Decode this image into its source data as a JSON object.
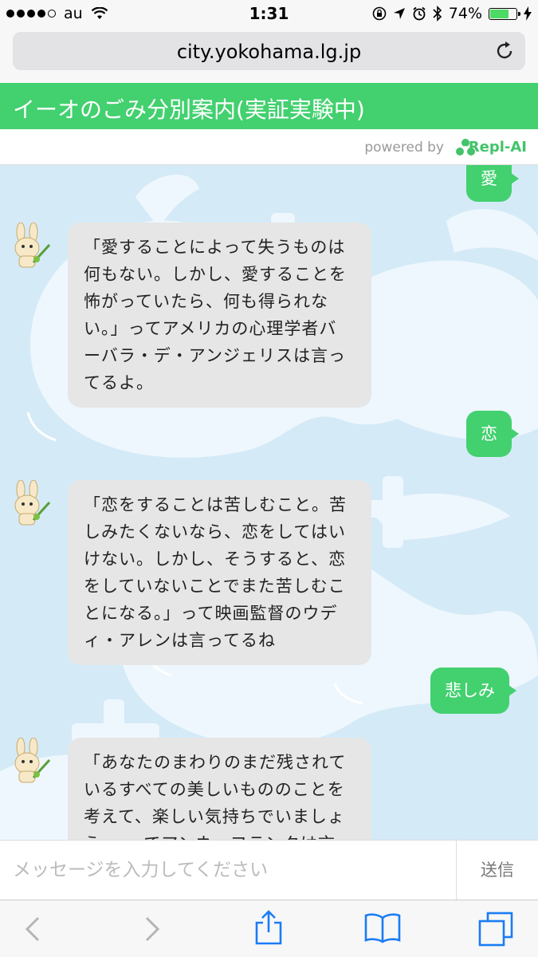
{
  "status_bar": {
    "carrier": "au",
    "time": "1:31",
    "battery_percent": "74%",
    "battery_level": 0.74
  },
  "browser": {
    "url": "city.yokohama.lg.jp"
  },
  "app": {
    "title": "イーオのごみ分別案内(実証実験中)",
    "powered_by": "powered by",
    "brand": "Repl-AI",
    "accent_color": "#43d06f"
  },
  "messages": [
    {
      "from": "user",
      "text": "愛"
    },
    {
      "from": "bot",
      "lines": [
        "「愛することによって失うものは",
        "何もない。しかし、愛することを",
        "怖がっていたら、何も得られな",
        "い。」ってアメリカの心理学者バ",
        "ーバラ・デ・アンジェリスは言っ",
        "てるよ。"
      ]
    },
    {
      "from": "user",
      "text": "恋"
    },
    {
      "from": "bot",
      "lines": [
        "「恋をすることは苦しむこと。苦",
        "しみたくないなら、恋をしてはい",
        "けない。しかし、そうすると、恋",
        "をしていないことでまた苦しむこ",
        "とになる。」って映画監督のウデ",
        "ィ・アレンは言ってるね"
      ]
    },
    {
      "from": "user",
      "text": "悲しみ"
    },
    {
      "from": "bot",
      "lines": [
        "「あなたのまわりのまだ残されて",
        "いるすべての美しいもののことを",
        "考えて、楽しい気持ちでいましょ",
        "う。」ってアンネ・フランクは言"
      ]
    }
  ],
  "input": {
    "placeholder": "メッセージを入力してください",
    "send_label": "送信"
  }
}
